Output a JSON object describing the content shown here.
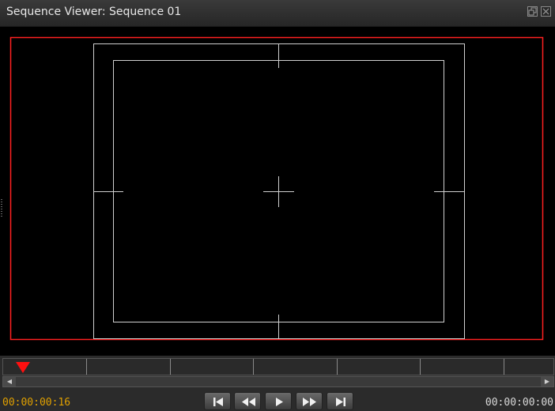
{
  "window": {
    "title": "Sequence Viewer: Sequence 01",
    "controls": [
      "float-icon",
      "close-icon"
    ]
  },
  "viewer": {
    "background": "#000000",
    "frame_border_color": "#ff2020",
    "guides_color": "#d0d0d0",
    "overlays": [
      "action-safe-area",
      "title-safe-area",
      "center-crosshair"
    ]
  },
  "timeline": {
    "playhead_color": "#ff1010"
  },
  "transport": {
    "current_timecode": "00:00:00:16",
    "duration_timecode": "00:00:00:00",
    "current_timecode_color": "#e0a000",
    "buttons": [
      "go-to-start",
      "rewind",
      "play",
      "fast-forward",
      "go-to-end"
    ]
  }
}
